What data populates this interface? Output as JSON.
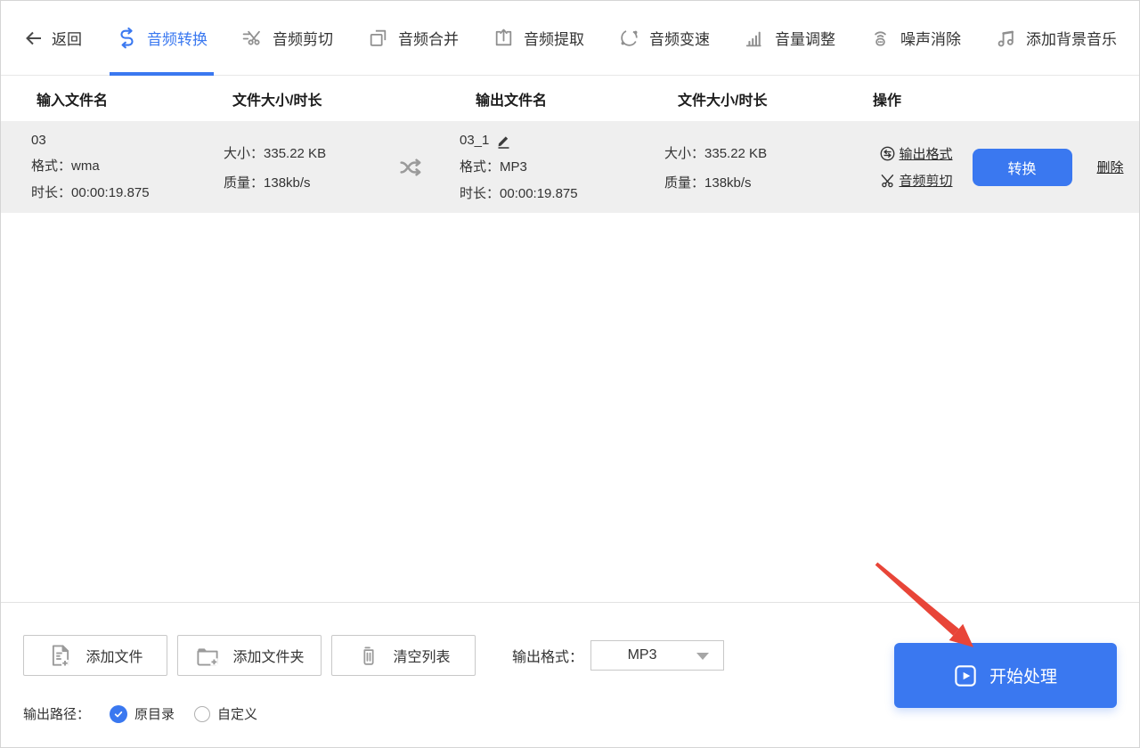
{
  "colors": {
    "accent": "#3a78f0",
    "row_bg": "#efefef",
    "annotation_arrow": "#e84538"
  },
  "toolbar": {
    "back_label": "返回",
    "tabs": [
      {
        "label": "音频转换",
        "icon": "audio-convert-icon",
        "active": true
      },
      {
        "label": "音频剪切",
        "icon": "audio-cut-icon",
        "active": false
      },
      {
        "label": "音频合并",
        "icon": "audio-merge-icon",
        "active": false
      },
      {
        "label": "音频提取",
        "icon": "audio-extract-icon",
        "active": false
      },
      {
        "label": "音频变速",
        "icon": "audio-speed-icon",
        "active": false
      },
      {
        "label": "音量调整",
        "icon": "volume-adjust-icon",
        "active": false
      },
      {
        "label": "噪声消除",
        "icon": "noise-removal-icon",
        "active": false
      },
      {
        "label": "添加背景音乐",
        "icon": "add-bgm-icon",
        "active": false
      }
    ]
  },
  "table": {
    "headers": [
      "输入文件名",
      "文件大小/时长",
      "输出文件名",
      "文件大小/时长",
      "操作"
    ],
    "rows": [
      {
        "input_name": "03",
        "format_label": "格式：",
        "duration_label": "时长：",
        "size_label": "大小：",
        "quality_label": "质量：",
        "input_format": "wma",
        "input_duration": "00:00:19.875",
        "input_size": "335.22 KB",
        "input_quality": "138kb/s",
        "output_name": "03_1",
        "output_format": "MP3",
        "output_duration": "00:00:19.875",
        "output_size": "335.22 KB",
        "output_quality": "138kb/s",
        "actions": {
          "output_format_link": "输出格式",
          "audio_cut_link": "音频剪切",
          "convert_button": "转换",
          "delete_link": "删除"
        }
      }
    ]
  },
  "footer": {
    "add_file_button": "添加文件",
    "add_folder_button": "添加文件夹",
    "clear_list_button": "清空列表",
    "output_format_label": "输出格式：",
    "output_format_value": "MP3",
    "start_button": "开始处理",
    "output_path_label": "输出路径：",
    "path_options": [
      {
        "label": "原目录",
        "selected": true
      },
      {
        "label": "自定义",
        "selected": false
      }
    ]
  }
}
